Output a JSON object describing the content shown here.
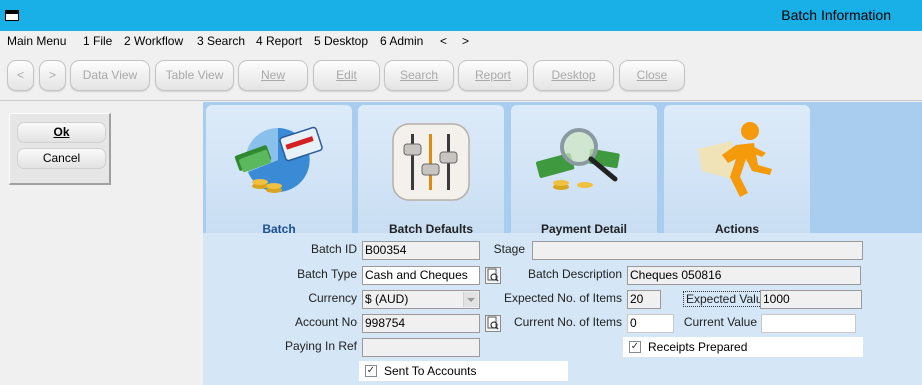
{
  "window": {
    "title": "Batch Information"
  },
  "menu": {
    "items": [
      "Main Menu",
      "1 File",
      "2 Workflow",
      "3 Search",
      "4 Report",
      "5 Desktop",
      "6 Admin",
      "<",
      ">"
    ]
  },
  "toolbar": {
    "back": "<",
    "forward": ">",
    "data_view": "Data View",
    "table_view": "Table View",
    "new": "New",
    "edit": "Edit",
    "search": "Search",
    "report": "Report",
    "desktop": "Desktop",
    "close": "Close"
  },
  "dialog": {
    "ok": "Ok",
    "cancel": "Cancel"
  },
  "tabs": [
    {
      "label": "Batch",
      "icon": "credit-card-money-icon",
      "active": true
    },
    {
      "label": "Batch Defaults",
      "icon": "mixer-sliders-icon",
      "active": false
    },
    {
      "label": "Payment Detail",
      "icon": "magnifier-money-icon",
      "active": false
    },
    {
      "label": "Actions",
      "icon": "running-man-icon",
      "active": false
    }
  ],
  "form": {
    "batch_id": {
      "label": "Batch ID",
      "value": "B00354"
    },
    "stage": {
      "label": "Stage",
      "value": ""
    },
    "batch_type": {
      "label": "Batch Type",
      "value": "Cash and Cheques"
    },
    "batch_description": {
      "label": "Batch Description",
      "value": "Cheques 050816"
    },
    "currency": {
      "label": "Currency",
      "value": "$ (AUD)"
    },
    "expected_items": {
      "label": "Expected No. of Items",
      "value": "20"
    },
    "expected_value": {
      "label": "Expected Value",
      "value": "1000"
    },
    "account_no": {
      "label": "Account No",
      "value": "998754"
    },
    "current_items": {
      "label": "Current No. of Items",
      "value": "0"
    },
    "current_value": {
      "label": "Current Value",
      "value": ""
    },
    "paying_in_ref": {
      "label": "Paying In Ref",
      "value": ""
    },
    "receipts_prepared": {
      "label": "Receipts Prepared",
      "checked": true
    },
    "sent_to_accounts": {
      "label": "Sent To Accounts",
      "checked": true
    }
  },
  "colors": {
    "titlebar": "#19b0e7",
    "tabstrip": "#a9cdee",
    "content": "#d5e6f6",
    "active_tab_text": "#1c4f8e"
  }
}
